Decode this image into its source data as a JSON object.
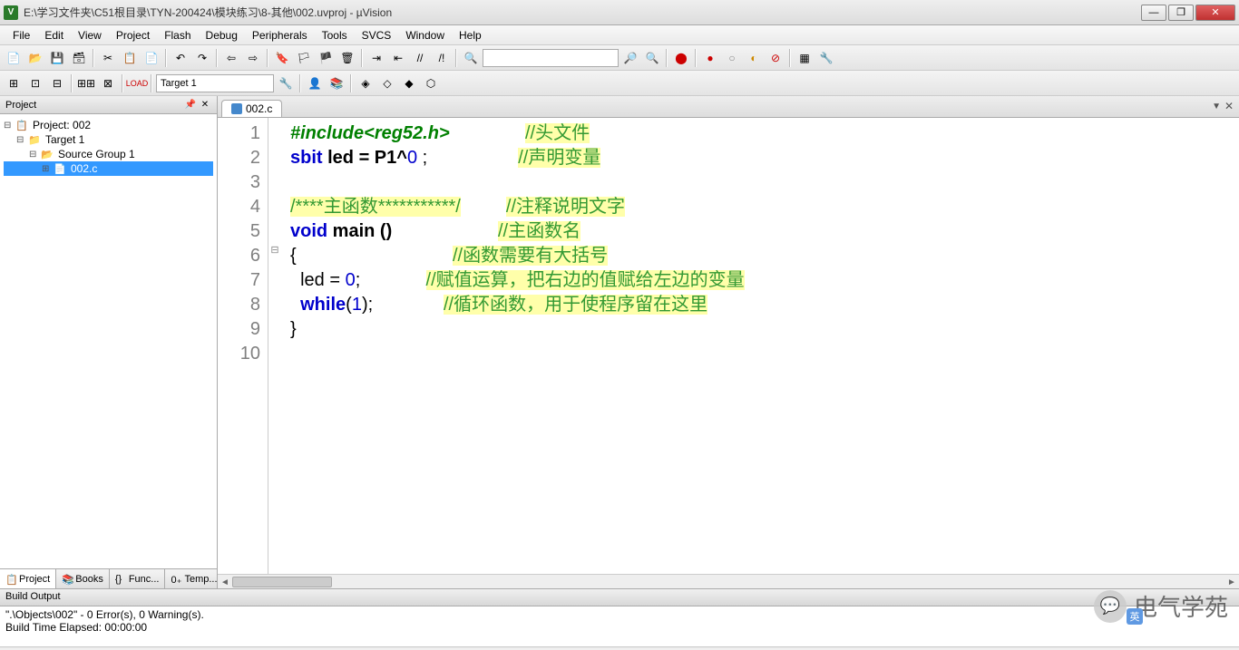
{
  "title": "E:\\学习文件夹\\C51根目录\\TYN-200424\\模块练习\\8-其他\\002.uvproj - µVision",
  "menu": [
    "File",
    "Edit",
    "View",
    "Project",
    "Flash",
    "Debug",
    "Peripherals",
    "Tools",
    "SVCS",
    "Window",
    "Help"
  ],
  "toolbar2": {
    "target": "Target 1"
  },
  "project_panel": {
    "title": "Project",
    "root": "Project: 002",
    "target": "Target 1",
    "group": "Source Group 1",
    "file": "002.c",
    "tabs": [
      "Project",
      "Books",
      "Func...",
      "Temp..."
    ]
  },
  "editor": {
    "tab": "002.c",
    "lines": [
      {
        "n": "1",
        "seg": [
          {
            "t": "#include<reg52.h>",
            "c": "pp"
          },
          {
            "t": "               ",
            "c": ""
          },
          {
            "t": "//头文件",
            "c": "cm hl"
          }
        ]
      },
      {
        "n": "2",
        "seg": [
          {
            "t": "sbit",
            "c": "kw"
          },
          {
            "t": " led = P1^",
            "c": "fn"
          },
          {
            "t": "0",
            "c": "num"
          },
          {
            "t": " ;",
            "c": ""
          },
          {
            "t": "                  ",
            "c": ""
          },
          {
            "t": "//声明变量",
            "c": "cm hl"
          }
        ]
      },
      {
        "n": "3",
        "seg": []
      },
      {
        "n": "4",
        "seg": [
          {
            "t": "/****主函数***********/",
            "c": "cm hl"
          },
          {
            "t": "         ",
            "c": ""
          },
          {
            "t": "//注释说明文字",
            "c": "cm hl"
          }
        ]
      },
      {
        "n": "5",
        "seg": [
          {
            "t": "void",
            "c": "kw"
          },
          {
            "t": " main ()",
            "c": "fn"
          },
          {
            "t": "                     ",
            "c": ""
          },
          {
            "t": "//主函数名",
            "c": "cm hl"
          }
        ]
      },
      {
        "n": "6",
        "fold": "⊟",
        "seg": [
          {
            "t": "{",
            "c": ""
          },
          {
            "t": "                               ",
            "c": ""
          },
          {
            "t": "//函数需要有大括号",
            "c": "cm hl"
          }
        ]
      },
      {
        "n": "7",
        "seg": [
          {
            "t": "  led = ",
            "c": ""
          },
          {
            "t": "0",
            "c": "num"
          },
          {
            "t": ";",
            "c": ""
          },
          {
            "t": "             ",
            "c": ""
          },
          {
            "t": "//赋值运算，把右边的值赋给左边的变量",
            "c": "cm hl"
          }
        ]
      },
      {
        "n": "8",
        "seg": [
          {
            "t": "  ",
            "c": ""
          },
          {
            "t": "while",
            "c": "kw"
          },
          {
            "t": "(",
            "c": ""
          },
          {
            "t": "1",
            "c": "num"
          },
          {
            "t": ");",
            "c": ""
          },
          {
            "t": "              ",
            "c": ""
          },
          {
            "t": "//循环函数，用于使程序留在这里",
            "c": "cm hl"
          }
        ]
      },
      {
        "n": "9",
        "seg": [
          {
            "t": "}",
            "c": ""
          }
        ]
      },
      {
        "n": "10",
        "seg": []
      }
    ]
  },
  "build": {
    "title": "Build Output",
    "line1": "\".\\Objects\\002\" - 0 Error(s), 0 Warning(s).",
    "line2": "Build Time Elapsed:  00:00:00"
  },
  "watermark": "电气学苑"
}
